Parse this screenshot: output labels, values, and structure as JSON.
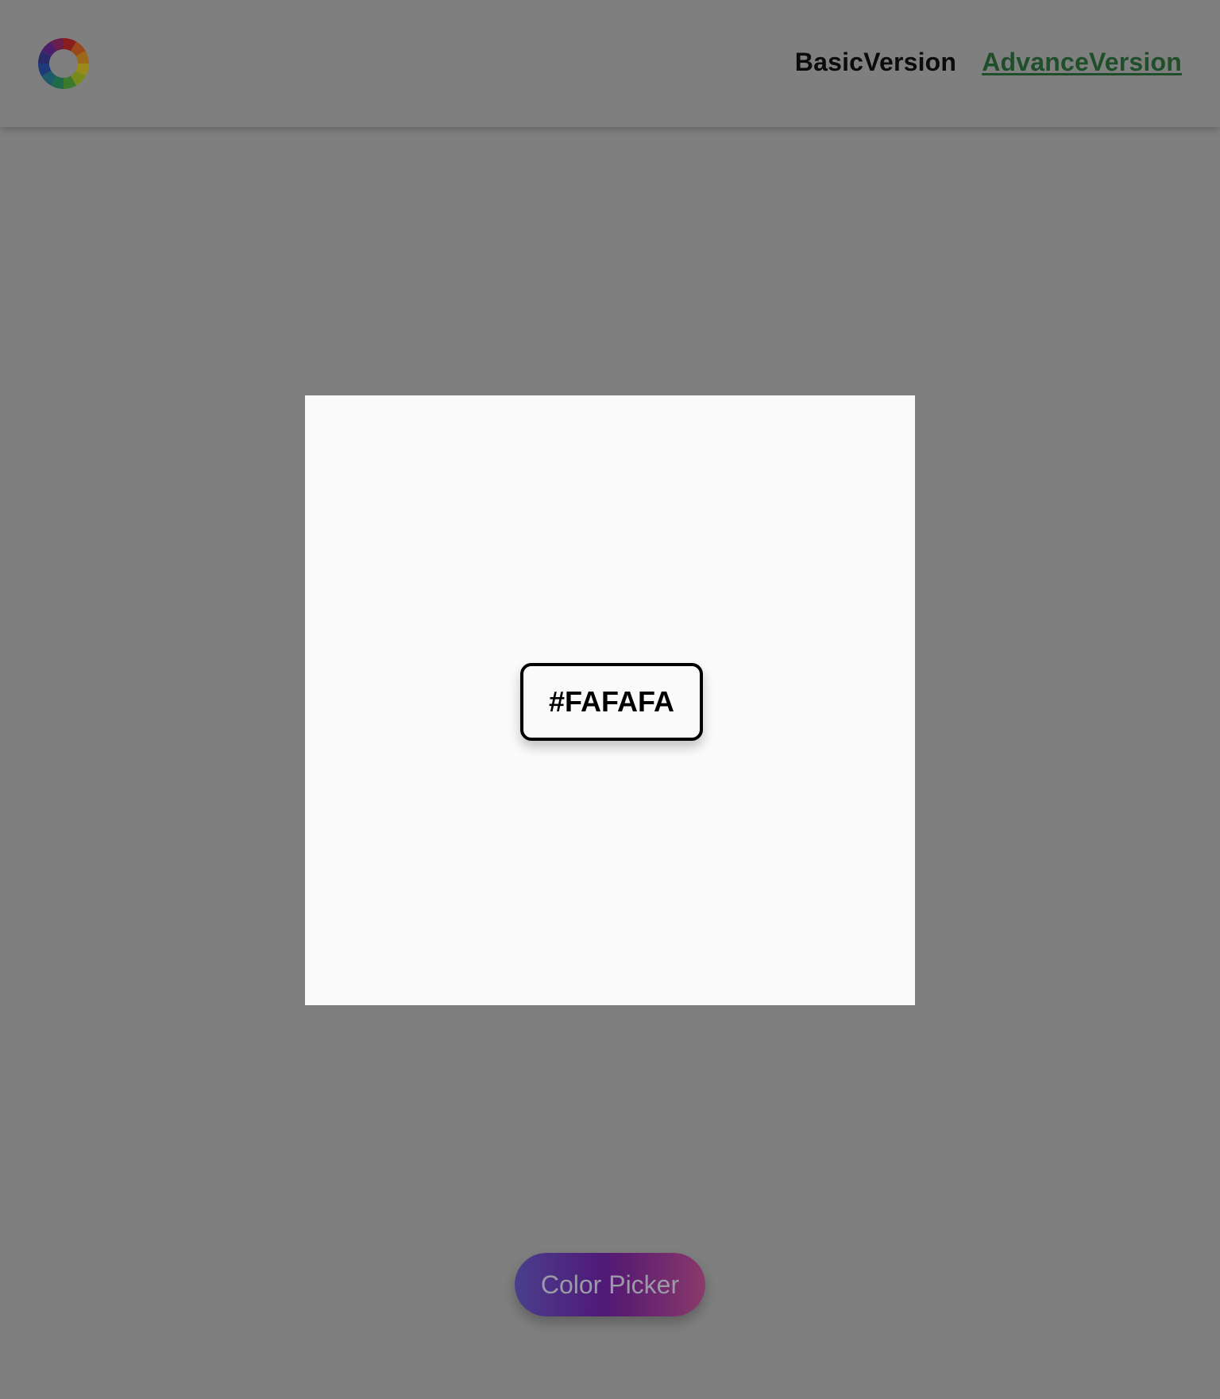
{
  "header": {
    "logo_icon": "color-wheel-icon",
    "nav": [
      {
        "label": "BasicVersion",
        "active": false
      },
      {
        "label": "AdvanceVersion",
        "active": true
      }
    ]
  },
  "preview": {
    "color": "#FAFAFA",
    "hex_label": "#FAFAFA"
  },
  "picker_button": {
    "label": "Color Picker"
  },
  "colors": {
    "background": "#7f7f7f",
    "advance_link": "#1f4e2a"
  }
}
